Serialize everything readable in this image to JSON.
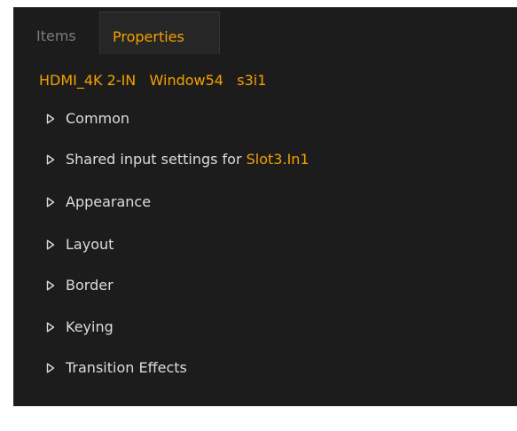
{
  "tabs": {
    "items_label": "Items",
    "properties_label": "Properties"
  },
  "selection": {
    "title": "HDMI_4K 2-IN   Window54   s3i1"
  },
  "sections": [
    {
      "label": "Common"
    },
    {
      "label": "Shared input settings for ",
      "accent": "Slot3.In1"
    },
    {
      "label": "Appearance"
    },
    {
      "label": "Layout"
    },
    {
      "label": "Border"
    },
    {
      "label": "Keying"
    },
    {
      "label": "Transition Effects"
    }
  ],
  "colors": {
    "accent": "#f5a000",
    "text": "#dcdcdc",
    "muted": "#7c7c7c",
    "panel": "#1c1c1c"
  },
  "icons": {
    "expand": "triangle-right-icon"
  }
}
